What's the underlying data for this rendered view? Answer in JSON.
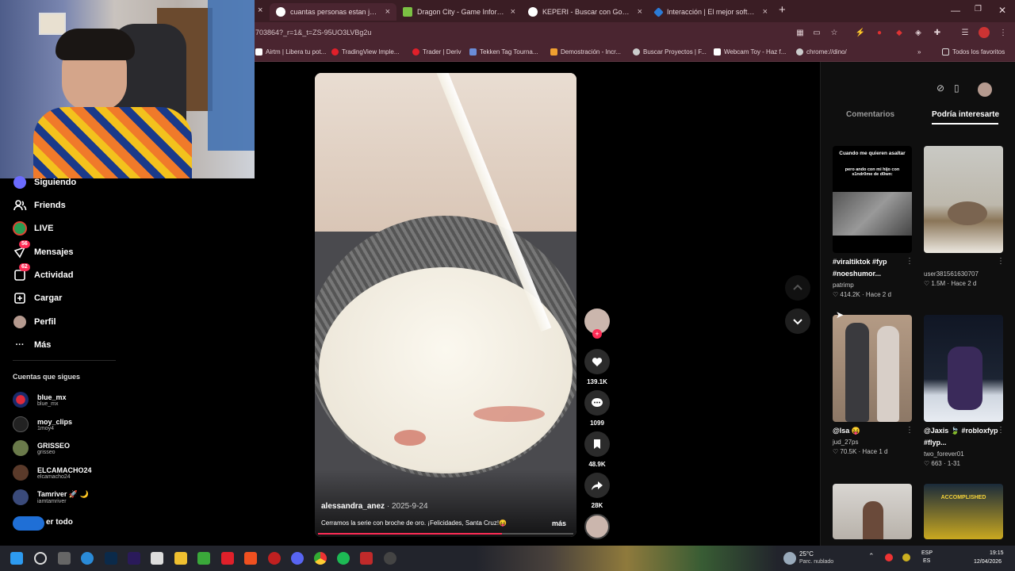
{
  "browser": {
    "tabs": [
      {
        "title": "cuantas personas estan jugando",
        "icon": "google-icon"
      },
      {
        "title": "Dragon City - Game Informatio",
        "icon": "dragon-city-icon"
      },
      {
        "title": "KEPERI - Buscar con Google",
        "icon": "google-icon"
      },
      {
        "title": "Interacción | El mejor software",
        "icon": "interaccion-icon"
      }
    ],
    "new_tab": "+",
    "url": "703864?_r=1&_t=ZS-95UO3LVBg2u",
    "bookmarks": [
      "Airtm | Libera tu pot...",
      "TradingView Imple...",
      "Trader | Deriv",
      "Tekken Tag Tourna...",
      "Demostración - Incr...",
      "Buscar Proyectos | F...",
      "Webcam Toy - Haz f...",
      "chrome://dino/"
    ],
    "all_bookmarks": "Todos los favoritos"
  },
  "sidebar": {
    "nav": [
      {
        "label": "Siguiendo",
        "icon": "following-icon"
      },
      {
        "label": "Friends",
        "icon": "friends-icon"
      },
      {
        "label": "LIVE",
        "icon": "live-icon"
      },
      {
        "label": "Mensajes",
        "icon": "messages-icon",
        "badge": "56"
      },
      {
        "label": "Actividad",
        "icon": "activity-icon",
        "badge": "62"
      },
      {
        "label": "Cargar",
        "icon": "upload-icon"
      },
      {
        "label": "Perfil",
        "icon": "profile-icon"
      },
      {
        "label": "Más",
        "icon": "more-icon"
      }
    ],
    "following_title": "Cuentas que sigues",
    "accounts": [
      {
        "name": "blue_mx",
        "handle": "blue_mx"
      },
      {
        "name": "moy_clips",
        "handle": "1moy4"
      },
      {
        "name": "GRISSEO",
        "handle": "grisseo"
      },
      {
        "name": "ELCAMACHO24",
        "handle": "elcamacho24"
      },
      {
        "name": "Tamriver 🚀 🌙",
        "handle": "iamtamriver"
      }
    ],
    "see_all": "er todo"
  },
  "video": {
    "author": "alessandra_anez",
    "date": "2025-9-24",
    "caption": "Cerramos la serie con broche de oro. ¡Felicidades, Santa Cruz!😝",
    "more": "más",
    "progress": 0.72,
    "actions": [
      {
        "icon": "heart-icon",
        "count": "139.1K"
      },
      {
        "icon": "comment-icon",
        "count": "1099"
      },
      {
        "icon": "bookmark-icon",
        "count": "48.9K"
      },
      {
        "icon": "share-icon",
        "count": "28K"
      }
    ]
  },
  "panel": {
    "tabs": [
      "Comentarios",
      "Podría interesarte"
    ],
    "active_tab": 1,
    "cards": [
      {
        "overlay": [
          "Cuando me quieren asaltar",
          "pero ando con mi hijo con s1ndr0me de d0wn:"
        ],
        "caption": "#viraltiktok #fyp #noeshumor...",
        "user": "patrimp",
        "likes": "414.2K",
        "when": "Hace 2 d"
      },
      {
        "caption": "",
        "user": "user381561630707",
        "likes": "1.5M",
        "when": "Hace 2 d"
      },
      {
        "caption": "@lsa 😝",
        "user": "jud_27ps",
        "likes": "70.5K",
        "when": "Hace 1 d"
      },
      {
        "caption": "@Jaxis 🍃 #robloxfyp #flyp...",
        "user": "two_forever01",
        "likes": "663",
        "when": "1-31"
      },
      {
        "caption": "",
        "user": "",
        "likes": "",
        "when": ""
      },
      {
        "overlay": [
          "ACCOMPLISHED"
        ],
        "caption": "",
        "user": "",
        "likes": "",
        "when": ""
      }
    ]
  },
  "taskbar": {
    "weather_temp": "25°C",
    "weather_desc": "Parc. nublado",
    "lang1": "ESP",
    "lang2": "ES",
    "time": "19:15",
    "date": "12/04/2026"
  }
}
